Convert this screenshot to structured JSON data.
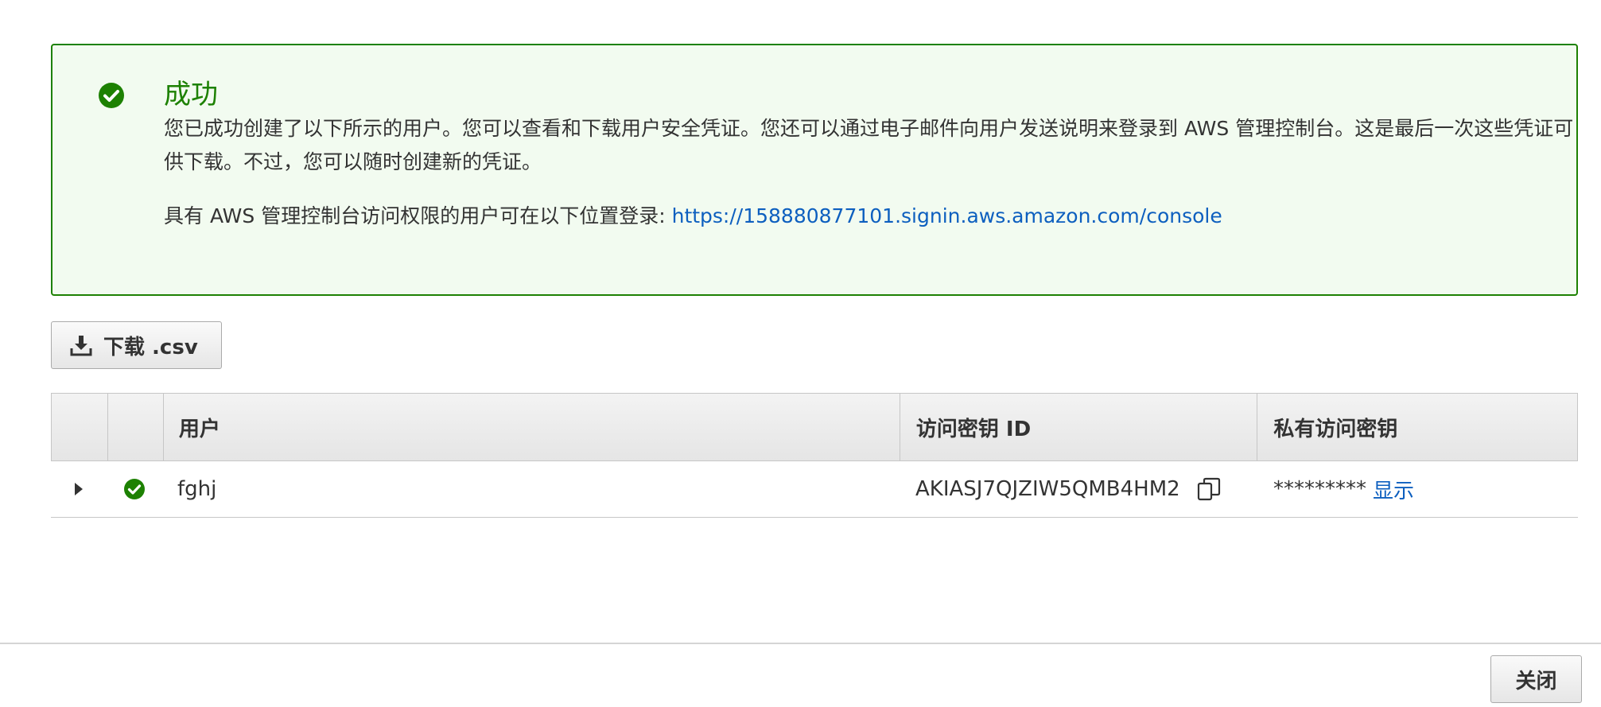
{
  "colors": {
    "success": "#1d8102",
    "success_bg": "#f2fbf0",
    "link": "#0d5fbf",
    "text": "#333333"
  },
  "alert": {
    "icon": "check-circle-icon",
    "title": "成功",
    "message": "您已成功创建了以下所示的用户。您可以查看和下载用户安全凭证。您还可以通过电子邮件向用户发送说明来登录到 AWS 管理控制台。这是最后一次这些凭证可供下载。不过，您可以随时创建新的凭证。",
    "login_text": "具有 AWS 管理控制台访问权限的用户可在以下位置登录: ",
    "login_url": "https://158880877101.signin.aws.amazon.com/console"
  },
  "download_button": {
    "icon": "download-icon",
    "label": "下载 .csv"
  },
  "table": {
    "headers": [
      "",
      "",
      "用户",
      "访问密钥 ID",
      "私有访问密钥"
    ],
    "rows": [
      {
        "expand_icon": "caret-right-icon",
        "status_icon": "check-circle-icon",
        "user": "fghj",
        "access_key_id": "AKIASJ7QJZIW5QMB4HM2",
        "secret_key_masked": "*********",
        "show_label": "显示"
      }
    ]
  },
  "footer": {
    "close_label": "关闭"
  }
}
